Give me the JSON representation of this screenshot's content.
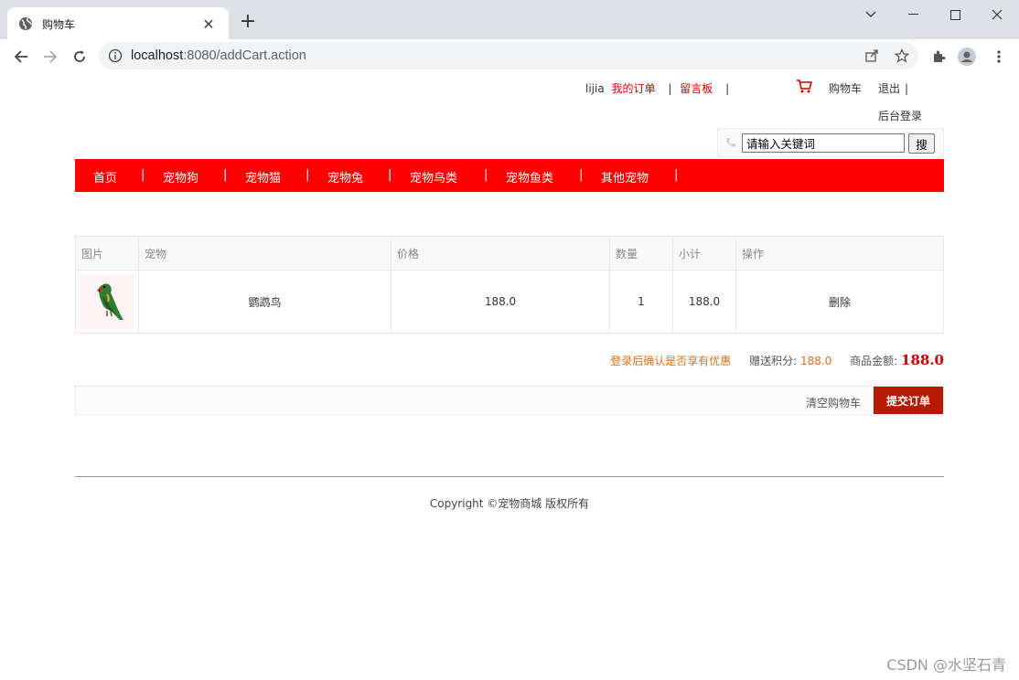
{
  "browser": {
    "tab_title": "购物车",
    "url_host": "localhost",
    "url_rest": ":8080/addCart.action"
  },
  "header": {
    "username": "lijia",
    "my_orders": "我的订单",
    "message_board": "留言板",
    "separator": "|",
    "cart": "购物车",
    "logout": "退出",
    "admin_login": "后台登录",
    "search_placeholder": "请输入关键词",
    "search_button": "搜"
  },
  "menu": {
    "items": [
      "首页",
      "宠物狗",
      "宠物猫",
      "宠物兔",
      "宠物鸟类",
      "宠物鱼类",
      "其他宠物"
    ],
    "separator": "|"
  },
  "cart": {
    "columns": [
      "图片",
      "宠物",
      "价格",
      "数量",
      "小计",
      "操作"
    ],
    "rows": [
      {
        "image_alt": "parrot",
        "pet": "鹦鹉鸟",
        "price": "188.0",
        "quantity": "1",
        "subtotal": "188.0",
        "action": "删除"
      }
    ],
    "login_note": "登录后确认是否享有优惠",
    "points_label": "赠送积分:",
    "points_value": "188.0",
    "total_label": "商品金额:",
    "total_value": "188.0",
    "clear_cart": "清空购物车",
    "submit_order": "提交订单"
  },
  "footer": {
    "copyright": "Copyright ©宠物商城 版权所有"
  },
  "watermark": "CSDN @水坚石青",
  "colors": {
    "menu_bg": "#ff0000",
    "submit_bg": "#b51a00",
    "accent_orange": "#e0701a"
  }
}
